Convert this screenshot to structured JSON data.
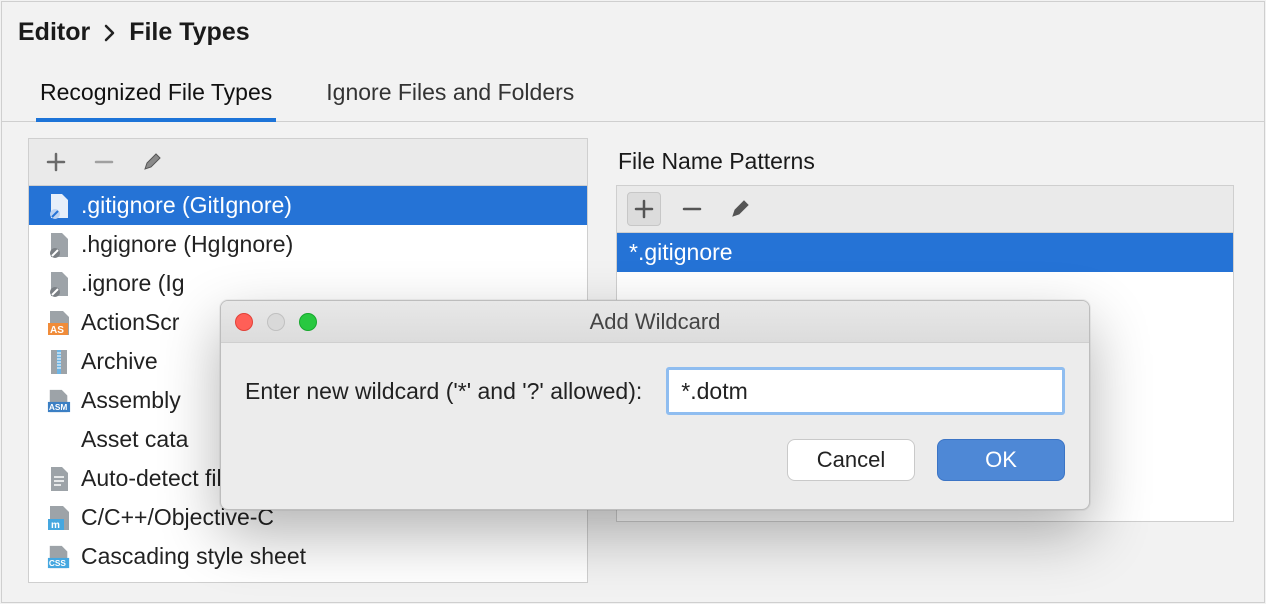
{
  "breadcrumb": {
    "item1": "Editor",
    "item2": "File Types"
  },
  "tabs": [
    {
      "label": "Recognized File Types",
      "active": true
    },
    {
      "label": "Ignore Files and Folders",
      "active": false
    }
  ],
  "left": {
    "items": [
      {
        "icon": "gitignore",
        "label": ".gitignore (GitIgnore)",
        "selected": true
      },
      {
        "icon": "gitignore",
        "label": ".hgignore (HgIgnore)"
      },
      {
        "icon": "gitignore",
        "label": ".ignore (Ig"
      },
      {
        "icon": "as",
        "label": "ActionScr"
      },
      {
        "icon": "archive",
        "label": "Archive"
      },
      {
        "icon": "asm",
        "label": "Assembly"
      },
      {
        "icon": "none",
        "label": "Asset cata"
      },
      {
        "icon": "text",
        "label": "Auto-detect file type by content"
      },
      {
        "icon": "m",
        "label": "C/C++/Objective-C"
      },
      {
        "icon": "css",
        "label": "Cascading style sheet"
      }
    ]
  },
  "right": {
    "title": "File Name Patterns",
    "items": [
      {
        "label": "*.gitignore",
        "selected": true
      }
    ]
  },
  "modal": {
    "title": "Add Wildcard",
    "prompt": "Enter new wildcard ('*' and '?' allowed):",
    "value": "*.dotm",
    "cancel": "Cancel",
    "ok": "OK"
  },
  "colors": {
    "selection": "#2573d6",
    "accent": "#4e88d6",
    "tab_underline": "#1d74d8"
  }
}
